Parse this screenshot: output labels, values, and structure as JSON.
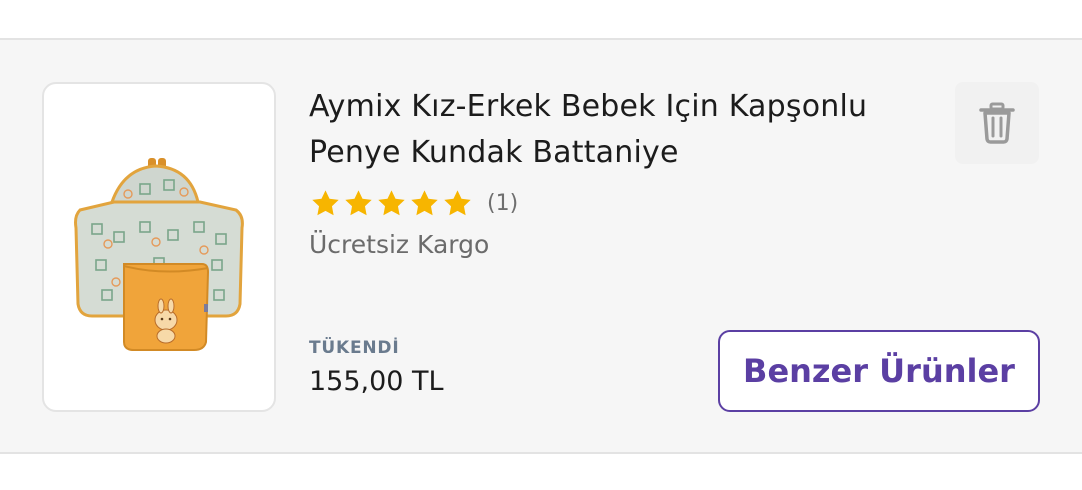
{
  "product": {
    "title": "Aymix Kız-Erkek Bebek Için Kapşonlu Penye Kundak Battaniye",
    "rating": 5,
    "rating_count": "(1)",
    "shipping": "Ücretsiz Kargo",
    "stock_status": "TÜKENDİ",
    "price": "155,00 TL",
    "image_alt": "product-image"
  },
  "actions": {
    "similar_label": "Benzer Ürünler",
    "delete_icon": "trash-icon"
  },
  "colors": {
    "accent": "#5b3fa3",
    "star": "#f7b500",
    "stock": "#6a7b8e",
    "blanket_orange": "#f0a43a"
  }
}
